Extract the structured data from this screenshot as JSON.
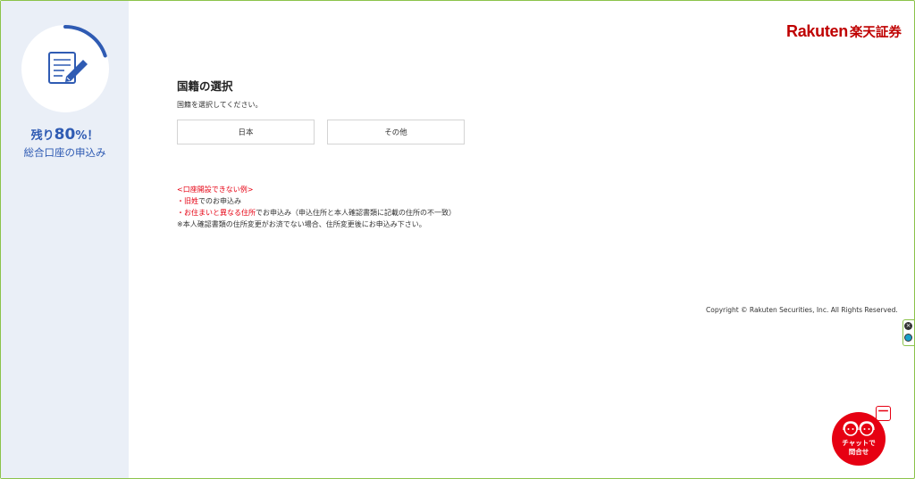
{
  "sidebar": {
    "progress_percent": 80,
    "remain_prefix": "残り",
    "remain_value": "80",
    "remain_suffix": "%！",
    "app_name": "総合口座の申込み",
    "icon": "form-edit-icon"
  },
  "header": {
    "logo_latin": "Rakuten",
    "logo_jp": "楽天証券"
  },
  "main": {
    "title": "国籍の選択",
    "instruction": "国籍を選択してください。",
    "options": [
      "日本",
      "その他"
    ]
  },
  "notice": {
    "heading": "<口座開設できない例>",
    "item1_bullet": "・",
    "item1_red": "旧姓",
    "item1_rest": "でのお申込み",
    "item2_bullet": "・",
    "item2_red": "お住まいと異なる住所",
    "item2_rest": "でお申込み（申込住所と本人確認書類に記載の住所の不一致）",
    "note": "※本人確認書類の住所変更がお済でない場合、住所変更後にお申込み下さい。"
  },
  "footer": {
    "copyright": "Copyright © Rakuten Securities, Inc. All Rights Reserved."
  },
  "chat": {
    "label_line1": "チャットで",
    "label_line2": "問合せ",
    "minimize_label": "－"
  },
  "colors": {
    "brand_red": "#bf0000",
    "accent_red": "#e60012",
    "sidebar_blue": "#2f5bb3",
    "sidebar_bg": "#eaeff7"
  }
}
